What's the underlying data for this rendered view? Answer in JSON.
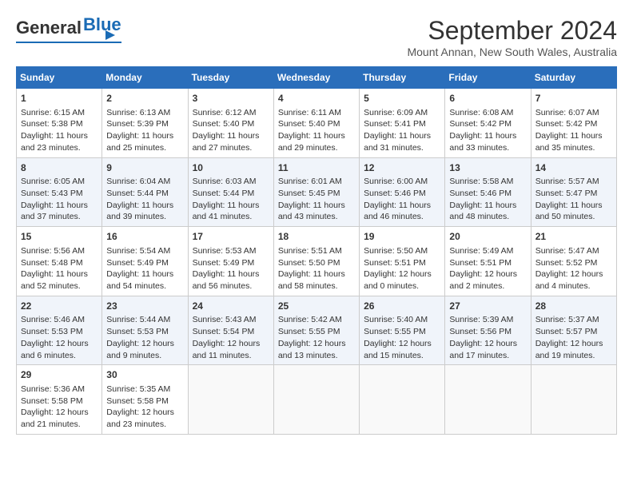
{
  "header": {
    "logo_general": "General",
    "logo_blue": "Blue",
    "month": "September 2024",
    "location": "Mount Annan, New South Wales, Australia"
  },
  "days": [
    "Sunday",
    "Monday",
    "Tuesday",
    "Wednesday",
    "Thursday",
    "Friday",
    "Saturday"
  ],
  "weeks": [
    [
      {
        "day": "1",
        "sunrise": "6:15 AM",
        "sunset": "5:38 PM",
        "daylight": "11 hours and 23 minutes."
      },
      {
        "day": "2",
        "sunrise": "6:13 AM",
        "sunset": "5:39 PM",
        "daylight": "11 hours and 25 minutes."
      },
      {
        "day": "3",
        "sunrise": "6:12 AM",
        "sunset": "5:40 PM",
        "daylight": "11 hours and 27 minutes."
      },
      {
        "day": "4",
        "sunrise": "6:11 AM",
        "sunset": "5:40 PM",
        "daylight": "11 hours and 29 minutes."
      },
      {
        "day": "5",
        "sunrise": "6:09 AM",
        "sunset": "5:41 PM",
        "daylight": "11 hours and 31 minutes."
      },
      {
        "day": "6",
        "sunrise": "6:08 AM",
        "sunset": "5:42 PM",
        "daylight": "11 hours and 33 minutes."
      },
      {
        "day": "7",
        "sunrise": "6:07 AM",
        "sunset": "5:42 PM",
        "daylight": "11 hours and 35 minutes."
      }
    ],
    [
      {
        "day": "8",
        "sunrise": "6:05 AM",
        "sunset": "5:43 PM",
        "daylight": "11 hours and 37 minutes."
      },
      {
        "day": "9",
        "sunrise": "6:04 AM",
        "sunset": "5:44 PM",
        "daylight": "11 hours and 39 minutes."
      },
      {
        "day": "10",
        "sunrise": "6:03 AM",
        "sunset": "5:44 PM",
        "daylight": "11 hours and 41 minutes."
      },
      {
        "day": "11",
        "sunrise": "6:01 AM",
        "sunset": "5:45 PM",
        "daylight": "11 hours and 43 minutes."
      },
      {
        "day": "12",
        "sunrise": "6:00 AM",
        "sunset": "5:46 PM",
        "daylight": "11 hours and 46 minutes."
      },
      {
        "day": "13",
        "sunrise": "5:58 AM",
        "sunset": "5:46 PM",
        "daylight": "11 hours and 48 minutes."
      },
      {
        "day": "14",
        "sunrise": "5:57 AM",
        "sunset": "5:47 PM",
        "daylight": "11 hours and 50 minutes."
      }
    ],
    [
      {
        "day": "15",
        "sunrise": "5:56 AM",
        "sunset": "5:48 PM",
        "daylight": "11 hours and 52 minutes."
      },
      {
        "day": "16",
        "sunrise": "5:54 AM",
        "sunset": "5:49 PM",
        "daylight": "11 hours and 54 minutes."
      },
      {
        "day": "17",
        "sunrise": "5:53 AM",
        "sunset": "5:49 PM",
        "daylight": "11 hours and 56 minutes."
      },
      {
        "day": "18",
        "sunrise": "5:51 AM",
        "sunset": "5:50 PM",
        "daylight": "11 hours and 58 minutes."
      },
      {
        "day": "19",
        "sunrise": "5:50 AM",
        "sunset": "5:51 PM",
        "daylight": "12 hours and 0 minutes."
      },
      {
        "day": "20",
        "sunrise": "5:49 AM",
        "sunset": "5:51 PM",
        "daylight": "12 hours and 2 minutes."
      },
      {
        "day": "21",
        "sunrise": "5:47 AM",
        "sunset": "5:52 PM",
        "daylight": "12 hours and 4 minutes."
      }
    ],
    [
      {
        "day": "22",
        "sunrise": "5:46 AM",
        "sunset": "5:53 PM",
        "daylight": "12 hours and 6 minutes."
      },
      {
        "day": "23",
        "sunrise": "5:44 AM",
        "sunset": "5:53 PM",
        "daylight": "12 hours and 9 minutes."
      },
      {
        "day": "24",
        "sunrise": "5:43 AM",
        "sunset": "5:54 PM",
        "daylight": "12 hours and 11 minutes."
      },
      {
        "day": "25",
        "sunrise": "5:42 AM",
        "sunset": "5:55 PM",
        "daylight": "12 hours and 13 minutes."
      },
      {
        "day": "26",
        "sunrise": "5:40 AM",
        "sunset": "5:55 PM",
        "daylight": "12 hours and 15 minutes."
      },
      {
        "day": "27",
        "sunrise": "5:39 AM",
        "sunset": "5:56 PM",
        "daylight": "12 hours and 17 minutes."
      },
      {
        "day": "28",
        "sunrise": "5:37 AM",
        "sunset": "5:57 PM",
        "daylight": "12 hours and 19 minutes."
      }
    ],
    [
      {
        "day": "29",
        "sunrise": "5:36 AM",
        "sunset": "5:58 PM",
        "daylight": "12 hours and 21 minutes."
      },
      {
        "day": "30",
        "sunrise": "5:35 AM",
        "sunset": "5:58 PM",
        "daylight": "12 hours and 23 minutes."
      },
      null,
      null,
      null,
      null,
      null
    ]
  ],
  "labels": {
    "sunrise": "Sunrise:",
    "sunset": "Sunset:",
    "daylight": "Daylight:"
  }
}
